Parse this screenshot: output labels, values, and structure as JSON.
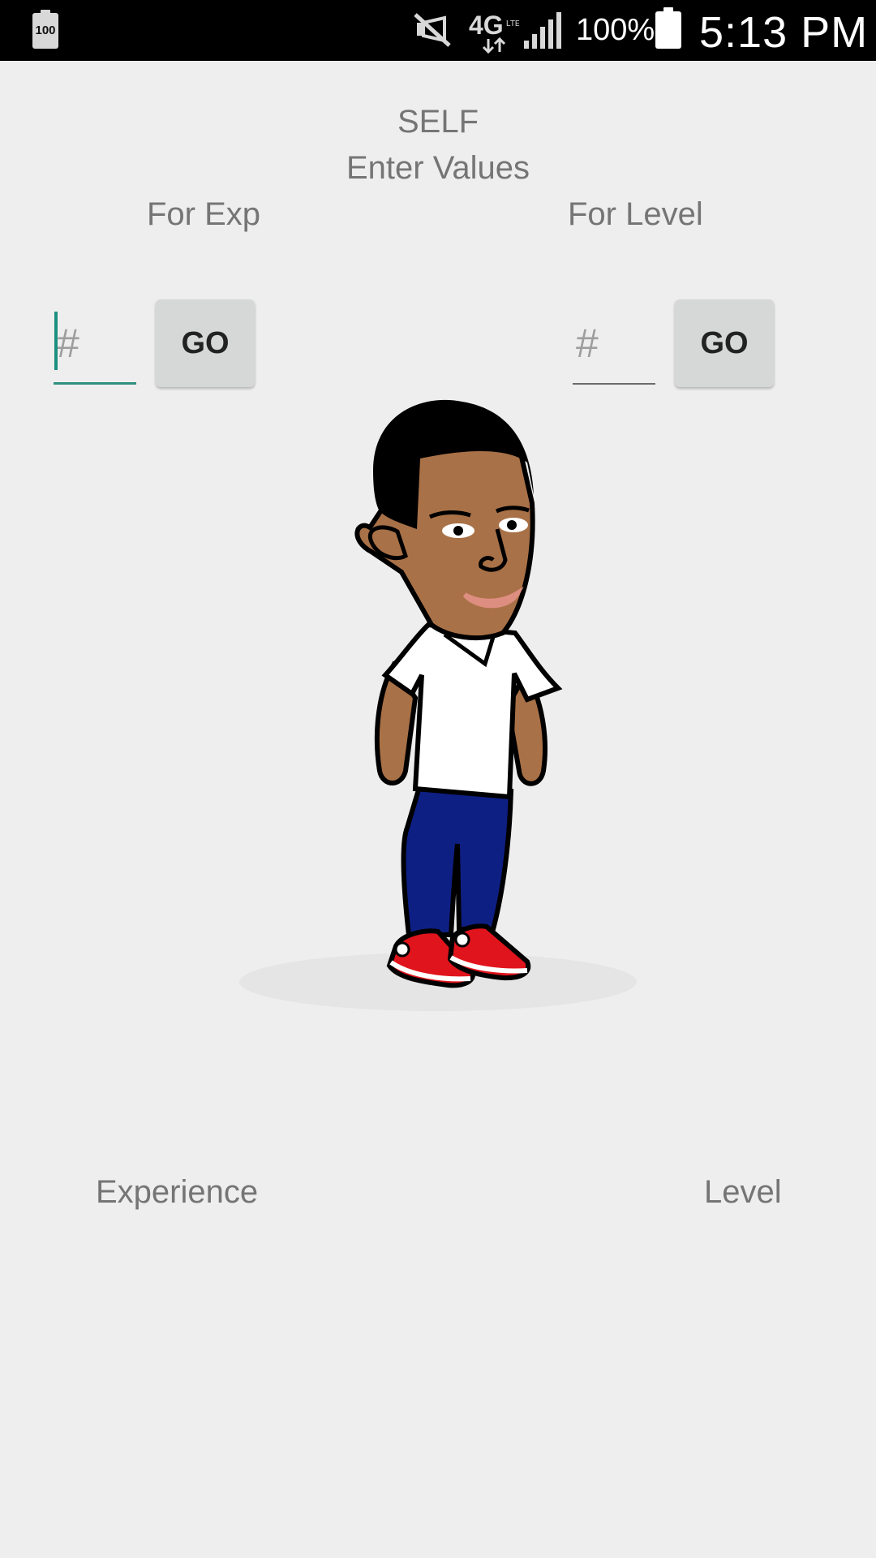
{
  "status_bar": {
    "battery_left_text": "100",
    "battery_percent": "100%",
    "time": "5:13 PM",
    "icons": [
      "battery-icon",
      "mute-icon",
      "4g-lte-icon",
      "signal-icon",
      "battery-full-icon"
    ]
  },
  "header": {
    "title": "SELF",
    "subtitle": "Enter Values"
  },
  "labels": {
    "for_exp": "For Exp",
    "for_level": "For Level"
  },
  "inputs": {
    "exp_placeholder": "#",
    "level_placeholder": "#"
  },
  "buttons": {
    "go_exp": "GO",
    "go_level": "GO"
  },
  "avatar": {
    "icon": "avatar-character",
    "colors": {
      "skin": "#a97147",
      "shirt": "#ffffff",
      "pants": "#0e1f84",
      "shoes": "#e0141c",
      "shadow": "#e6e5e6"
    }
  },
  "bottom": {
    "experience": "Experience",
    "level": "Level"
  }
}
